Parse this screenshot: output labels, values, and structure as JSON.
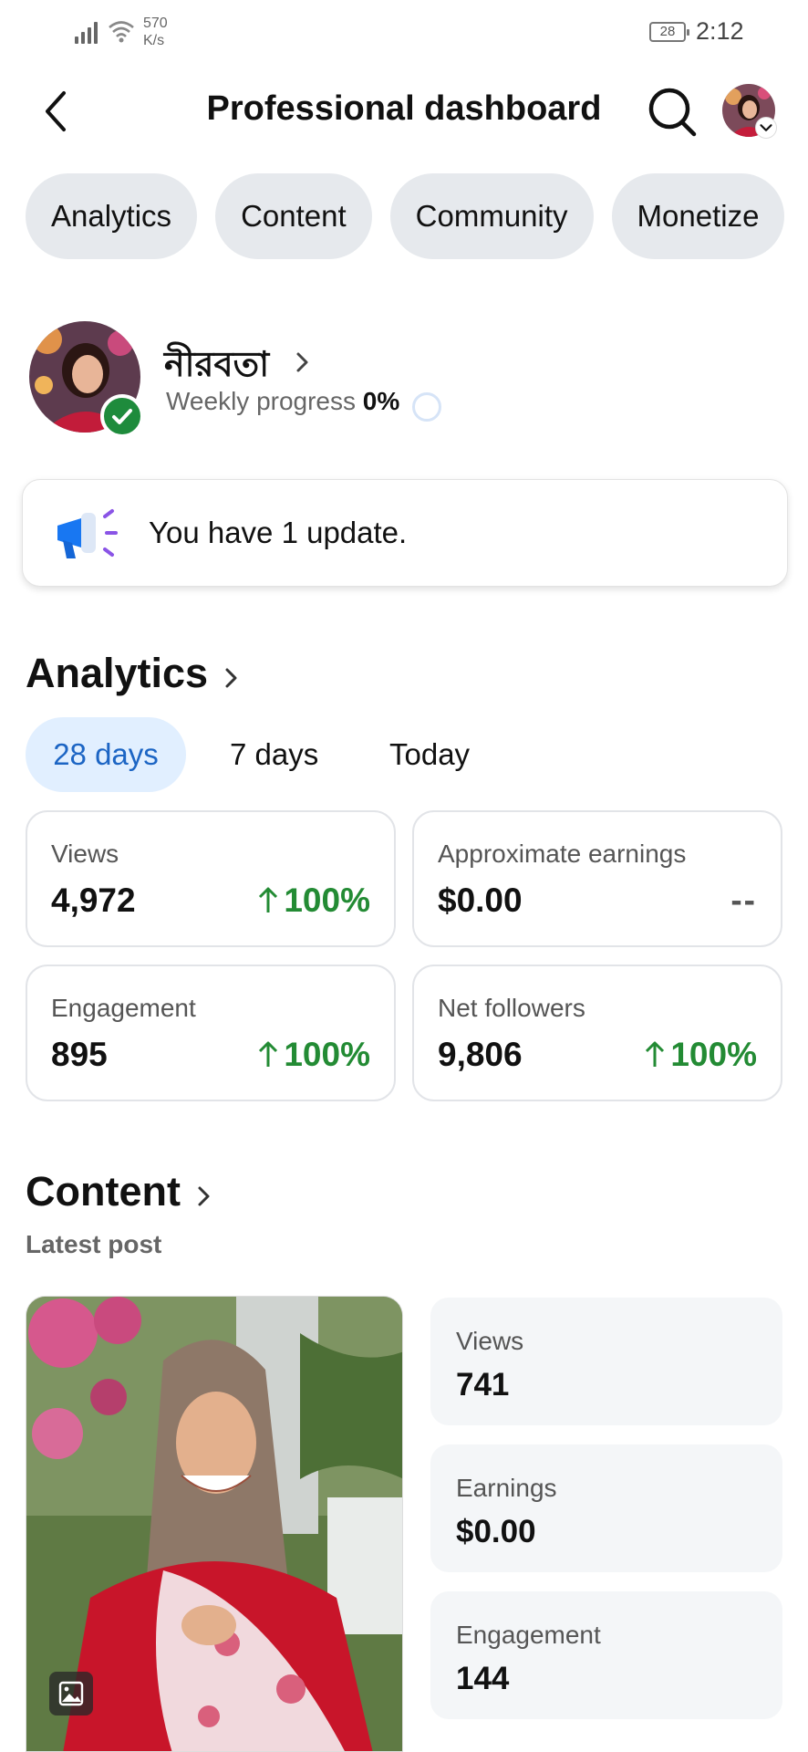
{
  "status_bar": {
    "net_speed_value": "570",
    "net_speed_unit": "K/s",
    "battery": "28",
    "time": "2:12"
  },
  "header": {
    "title": "Professional dashboard"
  },
  "tabs": [
    {
      "label": "Analytics"
    },
    {
      "label": "Content"
    },
    {
      "label": "Community"
    },
    {
      "label": "Monetize"
    }
  ],
  "profile": {
    "name": "নীরবতা",
    "progress_label": "Weekly progress",
    "progress_value": "0%",
    "weekly_progress_fraction": 0
  },
  "update_card": {
    "text": "You have 1 update."
  },
  "analytics": {
    "title": "Analytics",
    "date_filters": [
      {
        "label": "28 days",
        "selected": true
      },
      {
        "label": "7 days",
        "selected": false
      },
      {
        "label": "Today",
        "selected": false
      }
    ],
    "metrics": [
      {
        "label": "Views",
        "value": "4,972",
        "change": "100%",
        "trend": "up"
      },
      {
        "label": "Approximate earnings",
        "value": "$0.00",
        "change": "--",
        "trend": "none"
      },
      {
        "label": "Engagement",
        "value": "895",
        "change": "100%",
        "trend": "up"
      },
      {
        "label": "Net followers",
        "value": "9,806",
        "change": "100%",
        "trend": "up"
      }
    ]
  },
  "content": {
    "title": "Content",
    "subtitle": "Latest post",
    "post_stats": [
      {
        "label": "Views",
        "value": "741"
      },
      {
        "label": "Earnings",
        "value": "$0.00"
      },
      {
        "label": "Engagement",
        "value": "144"
      }
    ]
  },
  "colors": {
    "accent_blue": "#1c65c4",
    "positive_green": "#238b34",
    "chip_gray": "#e6e9ed",
    "selected_chip": "#e1efff"
  },
  "icons": [
    "signal-icon",
    "wifi-icon",
    "back-arrow-icon",
    "search-icon",
    "chevron-right-icon",
    "megaphone-icon",
    "arrow-up-icon",
    "verified-check-icon",
    "image-type-icon"
  ]
}
